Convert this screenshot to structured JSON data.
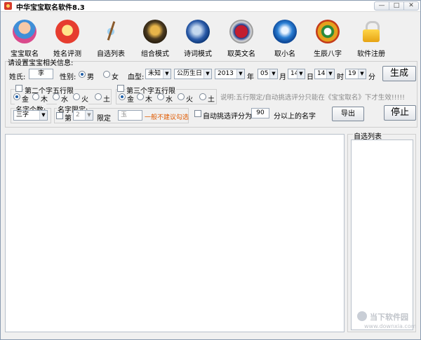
{
  "window": {
    "title": "中华宝宝取名软件8.3",
    "min": "—",
    "max": "□",
    "close": "✕"
  },
  "toolbar": [
    {
      "label": "宝宝取名",
      "icon": "baby-icon"
    },
    {
      "label": "姓名评测",
      "icon": "name-eval-icon"
    },
    {
      "label": "自选列表",
      "icon": "list-icon"
    },
    {
      "label": "组合模式",
      "icon": "combo-icon"
    },
    {
      "label": "诗词模式",
      "icon": "poem-book-icon"
    },
    {
      "label": "取英文名",
      "icon": "english-name-icon"
    },
    {
      "label": "取小名",
      "icon": "nickname-icon"
    },
    {
      "label": "生辰八字",
      "icon": "bazi-icon"
    },
    {
      "label": "软件注册",
      "icon": "lock-icon"
    }
  ],
  "settings": {
    "section_label": "请设置宝宝相关信息:",
    "surname_label": "姓氏:",
    "surname_value": "李",
    "gender_label": "性别:",
    "gender_male": "男",
    "gender_female": "女",
    "gender_selected": "男",
    "blood_label": "血型:",
    "blood_value": "未知",
    "calendar_value": "公历生日",
    "year_value": "2013",
    "year_unit": "年",
    "month_value": "05",
    "month_unit": "月",
    "day_value": "14",
    "day_unit": "日",
    "hour_value": "14",
    "hour_unit": "时",
    "minute_value": "19",
    "minute_unit": "分",
    "generate_button": "生成",
    "second_char_label": "第二个字五行限",
    "third_char_label": "第三个字五行限",
    "elements": [
      "金",
      "木",
      "水",
      "火",
      "土"
    ],
    "second_char_selected": "金",
    "third_char_selected": "金",
    "note": "说明:五行限定/自动挑选评分只能在《宝宝取名》下才生效!!!!!",
    "name_count_label": "名字个数:",
    "name_count_value": "三字",
    "name_limit_label": "名字限定:",
    "limit_pos_prefix": "第",
    "limit_pos_value": "2",
    "limit_suffix": "限定",
    "limit_char_value": "玉",
    "limit_hint": "一般不建议勾选",
    "auto_pick_label": "自动挑选评分为:",
    "auto_score_value": "90",
    "auto_score_suffix": "分以上的名字",
    "export_button": "导出",
    "stop_button": "停止"
  },
  "side": {
    "title": "自选列表"
  },
  "watermark": {
    "text": "当下软件园",
    "url": "www.downxia.com"
  }
}
